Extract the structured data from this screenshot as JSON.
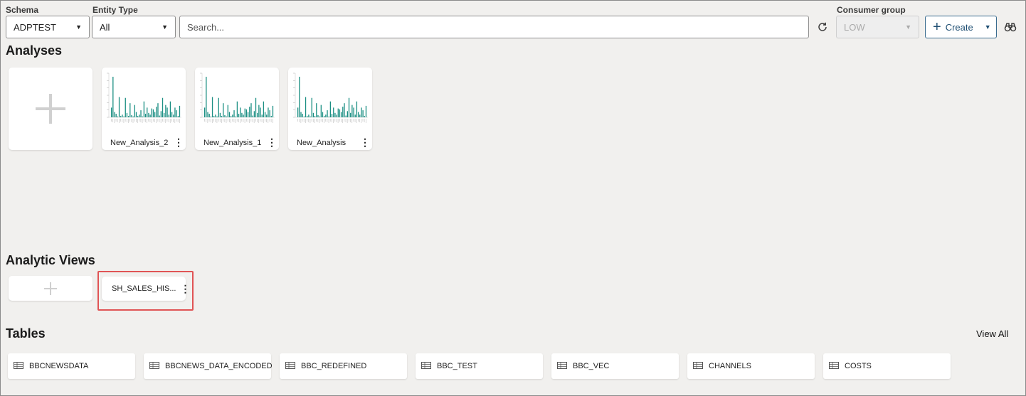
{
  "filters": {
    "schema_label": "Schema",
    "schema_value": "ADPTEST",
    "entity_type_label": "Entity Type",
    "entity_type_value": "All",
    "search_placeholder": "Search...",
    "consumer_group_label": "Consumer group",
    "consumer_group_value": "LOW",
    "create_label": "Create"
  },
  "analyses": {
    "title": "Analyses",
    "items": [
      {
        "name": "New_Analysis_2"
      },
      {
        "name": "New_Analysis_1"
      },
      {
        "name": "New_Analysis"
      }
    ]
  },
  "analytic_views": {
    "title": "Analytic Views",
    "items": [
      {
        "name": "SH_SALES_HIS..."
      }
    ]
  },
  "tables": {
    "title": "Tables",
    "view_all_label": "View All",
    "items": [
      {
        "name": "BBCNEWSDATA"
      },
      {
        "name": "BBCNEWS_DATA_ENCODED"
      },
      {
        "name": "BBC_REDEFINED"
      },
      {
        "name": "BBC_TEST"
      },
      {
        "name": "BBC_VEC"
      },
      {
        "name": "CHANNELS"
      },
      {
        "name": "COSTS"
      }
    ]
  },
  "colors": {
    "chart_bar": "#1b8f83",
    "highlight": "#e05455",
    "accent": "#1f4f73"
  },
  "thumbnail_chart": {
    "values": [
      0.22,
      0.92,
      0.12,
      0.08,
      0.02,
      0.46,
      0.03,
      0.06,
      0.02,
      0.44,
      0.1,
      0.03,
      0.32,
      0.05,
      0.02,
      0.28,
      0.12,
      0.03,
      0.06,
      0.16,
      0.02,
      0.36,
      0.08,
      0.22,
      0.1,
      0.06,
      0.2,
      0.18,
      0.12,
      0.24,
      0.32,
      0.04,
      0.14,
      0.44,
      0.1,
      0.28,
      0.22,
      0.06,
      0.36,
      0.12,
      0.06,
      0.22,
      0.16,
      0.03,
      0.26
    ]
  }
}
